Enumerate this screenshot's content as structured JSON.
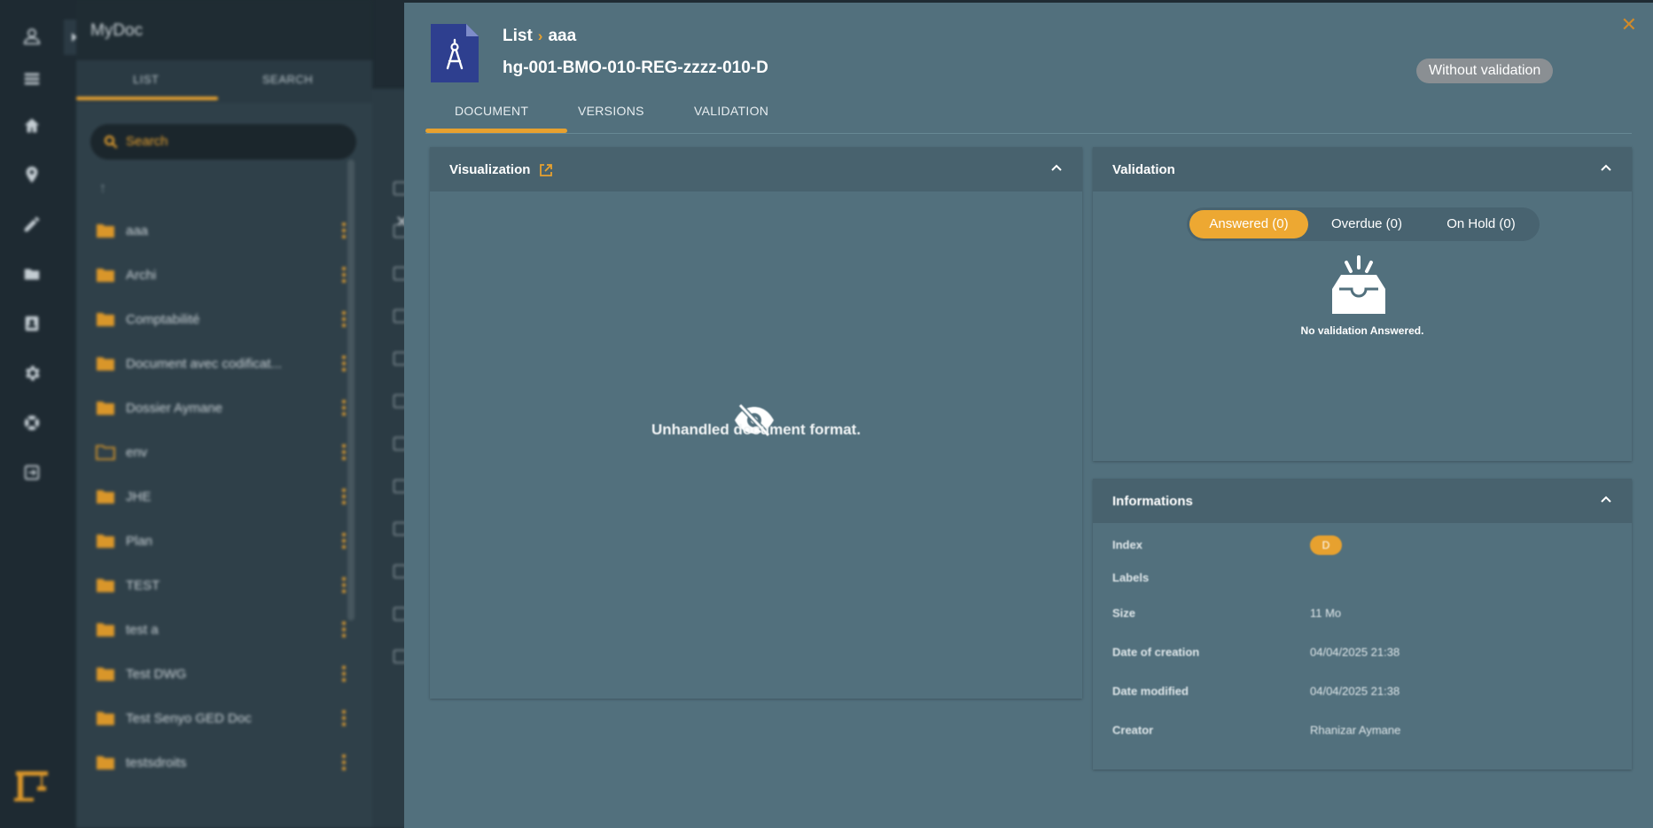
{
  "app": {
    "title": "MyDoc",
    "tabs": [
      "LIST",
      "SEARCH"
    ],
    "search_placeholder": "Search",
    "up_symbol": "↑",
    "folders": [
      {
        "name": "aaa",
        "open": false
      },
      {
        "name": "Archi",
        "open": false
      },
      {
        "name": "Comptabilité",
        "open": false
      },
      {
        "name": "Document avec codificat...",
        "open": false
      },
      {
        "name": "Dossier Aymane",
        "open": false
      },
      {
        "name": "env",
        "open": true
      },
      {
        "name": "JHE",
        "open": false
      },
      {
        "name": "Plan",
        "open": false
      },
      {
        "name": "TEST",
        "open": false
      },
      {
        "name": "test a",
        "open": false
      },
      {
        "name": "Test DWG",
        "open": false
      },
      {
        "name": "Test Senyo GED Doc",
        "open": false
      },
      {
        "name": "testsdroits",
        "open": false
      }
    ],
    "rail_icons": [
      "user-icon",
      "list-icon",
      "home-icon",
      "location-icon",
      "pencil-icon",
      "folder-icon",
      "contact-card-icon",
      "gear-icon",
      "support-icon",
      "exit-icon"
    ]
  },
  "modal": {
    "breadcrumb": {
      "root": "List",
      "separator": "›",
      "current": "aaa"
    },
    "document_name": "hg-001-BMO-010-REG-zzzz-010-D",
    "status_badge": "Without validation",
    "close_symbol": "✕",
    "tabs": [
      "DOCUMENT",
      "VERSIONS",
      "VALIDATION"
    ],
    "active_tab": "DOCUMENT",
    "visualization": {
      "title": "Visualization",
      "message": "Unhandled document format."
    },
    "validation": {
      "title": "Validation",
      "filters": [
        "Answered (0)",
        "Overdue (0)",
        "On Hold (0)"
      ],
      "active_filter": "Answered (0)",
      "empty_message": "No validation Answered."
    },
    "informations": {
      "title": "Informations",
      "rows": [
        {
          "label": "Index",
          "value": "D"
        },
        {
          "label": "Labels",
          "value": ""
        },
        {
          "label": "Size",
          "value": "11 Mo"
        },
        {
          "label": "Date of creation",
          "value": "04/04/2025 21:38"
        },
        {
          "label": "Date modified",
          "value": "04/04/2025 21:38"
        },
        {
          "label": "Creator",
          "value": "Rhanizar Aymane"
        }
      ]
    }
  },
  "colors": {
    "accent": "#e7a12f",
    "modal_bg": "#52707d",
    "card_header": "#48626e",
    "badge_bg": "#8a8f93",
    "doc_icon_bg": "#2e3f8f"
  }
}
